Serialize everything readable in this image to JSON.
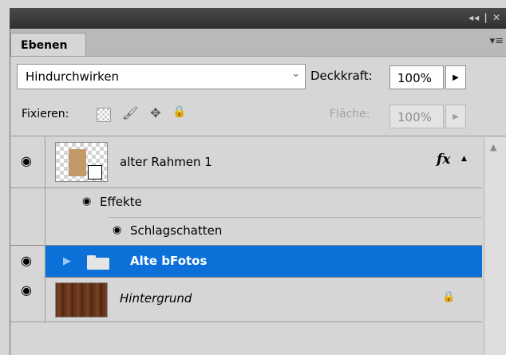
{
  "titlebar": {
    "controls": "◂◂ | ✕"
  },
  "tab": {
    "label": "Ebenen"
  },
  "panel_menu_icon": "▾≡",
  "blend": {
    "value": "Hindurchwirken",
    "chevron": "⌄"
  },
  "opacity": {
    "label": "Deckkraft:",
    "value": "100%",
    "arrow": "▶"
  },
  "lock": {
    "label": "Fixieren:",
    "icons": [
      "lock-transparent-icon",
      "brush-icon",
      "move-icon",
      "lock-icon"
    ]
  },
  "fill": {
    "label": "Fläche:",
    "value": "100%",
    "arrow": "▶"
  },
  "layers": [
    {
      "name": "alter Rahmen 1",
      "fx": "fx",
      "visible": true,
      "selected": false,
      "type": "smart-object"
    },
    {
      "name": "Effekte",
      "type": "effects-header"
    },
    {
      "name": "Schlagschatten",
      "type": "effect"
    },
    {
      "name": "Alte bFotos",
      "visible": true,
      "selected": true,
      "type": "group",
      "collapsed": true
    },
    {
      "name": "Hintergrund",
      "visible": true,
      "selected": false,
      "type": "background",
      "locked": true
    }
  ],
  "colors": {
    "selection": "#0b71d8",
    "panel_bg": "#d6d6d6",
    "titlebar": "#3b3b3b"
  },
  "glyphs": {
    "eye": "◉",
    "expand": "▶",
    "lock": "🔒",
    "move": "✥",
    "brush": "🖌",
    "up": "▲"
  }
}
